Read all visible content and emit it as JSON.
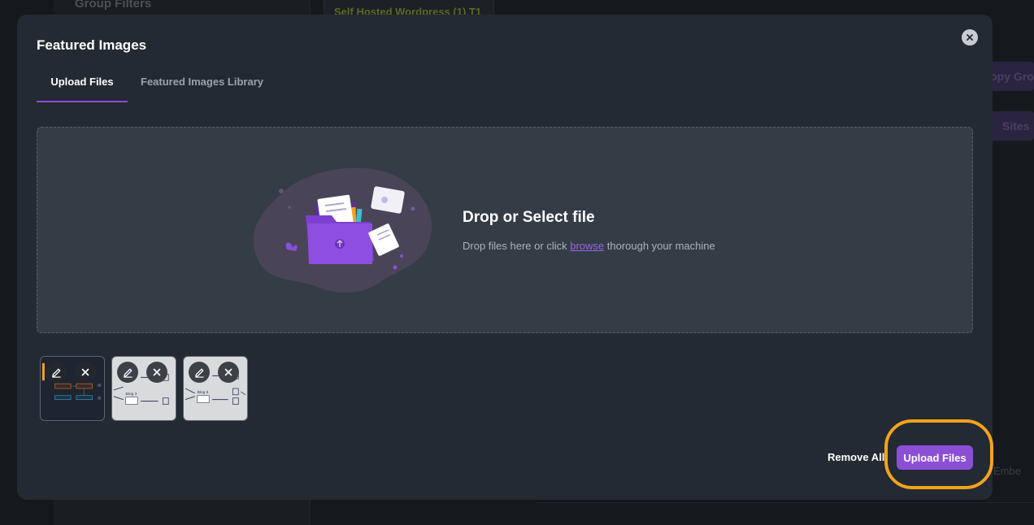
{
  "background": {
    "group_filters": "Group Filters",
    "tab_chip": "Self Hosted Wordpress (1) T1",
    "button1": "Copy Gro",
    "button2": "Sites",
    "embed_text": "Embe"
  },
  "modal": {
    "title": "Featured Images",
    "tabs": [
      {
        "label": "Upload Files",
        "active": true
      },
      {
        "label": "Featured Images Library",
        "active": false
      }
    ],
    "dropzone": {
      "title": "Drop or Select file",
      "subtitle_before": "Drop files here or click ",
      "browse_link": "browse",
      "subtitle_after": " thorough your machine"
    },
    "thumbnails": [
      {
        "name": "thumbnail-1",
        "style": "dark"
      },
      {
        "name": "thumbnail-2",
        "style": "light",
        "caption": "Blog 3"
      },
      {
        "name": "thumbnail-3",
        "style": "light",
        "caption": "Blog 8"
      }
    ],
    "footer": {
      "remove_all": "Remove All",
      "upload_files": "Upload Files"
    }
  },
  "colors": {
    "accent": "#8b4fd6",
    "highlight": "#f4a31a",
    "modal_bg": "#232a33",
    "dropzone_bg": "#343c46"
  }
}
